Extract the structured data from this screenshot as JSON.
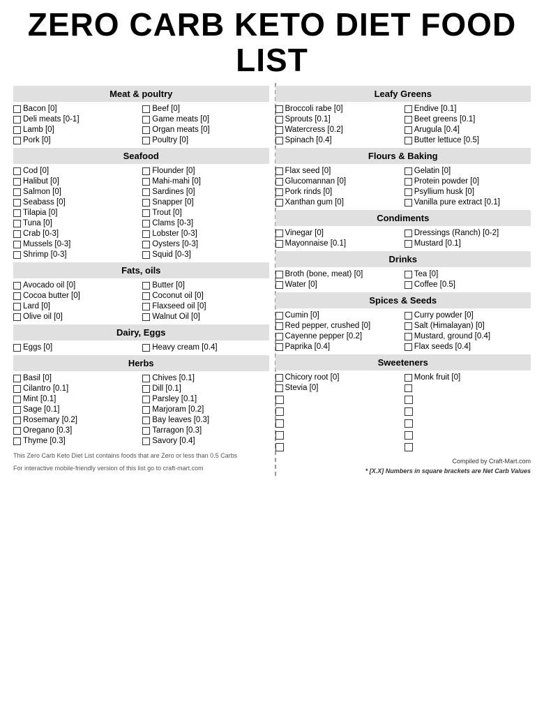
{
  "title": "ZERO CARB KETO DIET FOOD LIST",
  "sections": {
    "meat_poultry": {
      "label": "Meat & poultry",
      "items": [
        "Bacon [0]",
        "Beef [0]",
        "Deli meats [0-1]",
        "Game meats [0]",
        "Lamb [0]",
        "Organ meats [0]",
        "Pork [0]",
        "Poultry [0]"
      ]
    },
    "seafood": {
      "label": "Seafood",
      "items": [
        "Cod [0]",
        "Flounder [0]",
        "Halibut [0]",
        "Mahi-mahi [0]",
        "Salmon [0]",
        "Sardines [0]",
        "Seabass [0]",
        "Snapper [0]",
        "Tilapia [0]",
        "Trout [0]",
        "Tuna [0]",
        "Clams [0-3]",
        "Crab [0-3]",
        "Lobster [0-3]",
        "Mussels [0-3]",
        "Oysters [0-3]",
        "Shrimp [0-3]",
        "Squid [0-3]"
      ]
    },
    "fats_oils": {
      "label": "Fats, oils",
      "items": [
        "Avocado oil [0]",
        "Butter [0]",
        "Cocoa butter [0]",
        "Coconut oil [0]",
        "Lard [0]",
        "Flaxseed oil [0]",
        "Olive oil [0]",
        "Walnut Oil [0]"
      ]
    },
    "dairy_eggs": {
      "label": "Dairy, Eggs",
      "items": [
        "Eggs [0]",
        "Heavy cream [0.4]"
      ]
    },
    "herbs": {
      "label": "Herbs",
      "items": [
        "Basil [0]",
        "Chives [0.1]",
        "Cilantro [0.1]",
        "Dill [0.1]",
        "Mint [0.1]",
        "Parsley [0.1]",
        "Sage [0.1]",
        "Marjoram [0.2]",
        "Rosemary [0.2]",
        "Bay leaves [0.3]",
        "Oregano [0.3]",
        "Tarragon [0.3]",
        "Thyme [0.3]",
        "Savory [0.4]"
      ]
    },
    "leafy_greens": {
      "label": "Leafy Greens",
      "items": [
        "Broccoli rabe [0]",
        "Endive [0.1]",
        "Sprouts [0.1]",
        "Beet greens [0.1]",
        "Watercress [0.2]",
        "Arugula [0.4]",
        "Spinach [0.4]",
        "Butter lettuce [0.5]"
      ]
    },
    "flours_baking": {
      "label": "Flours & Baking",
      "items": [
        "Flax seed [0]",
        "Gelatin [0]",
        "Glucomannan [0]",
        "Protein powder [0]",
        "Pork rinds [0]",
        "Psyllium husk [0]",
        "Xanthan gum [0]",
        "Vanilla pure extract [0.1]"
      ]
    },
    "condiments": {
      "label": "Condiments",
      "items": [
        "Vinegar [0]",
        "Dressings (Ranch) [0-2]",
        "Mayonnaise [0.1]",
        "Mustard [0.1]"
      ]
    },
    "drinks": {
      "label": "Drinks",
      "items": [
        "Broth (bone, meat) [0]",
        "Tea [0]",
        "Water [0]",
        "Coffee [0.5]"
      ]
    },
    "spices_seeds": {
      "label": "Spices & Seeds",
      "items": [
        "Cumin [0]",
        "Curry powder [0]",
        "Red pepper, crushed [0]",
        "Salt (Himalayan) [0]",
        "Cayenne pepper [0.2]",
        "Mustard, ground [0.4]",
        "Paprika [0.4]",
        "Flax seeds [0.4]"
      ]
    },
    "sweeteners": {
      "label": "Sweeteners",
      "items": [
        "Chicory root [0]",
        "Monk fruit [0]",
        "Stevia [0]",
        ""
      ]
    }
  },
  "footer": {
    "left_line1": "This Zero Carb Keto Diet List contains foods that are Zero or less than 0.5 Carbs",
    "left_line2": "For interactive mobile-friendly version of this list go to craft-mart.com",
    "right_compiled": "Compiled by Craft-Mart.com",
    "right_note": "* [X.X] Numbers in square brackets are Net Carb Values"
  }
}
